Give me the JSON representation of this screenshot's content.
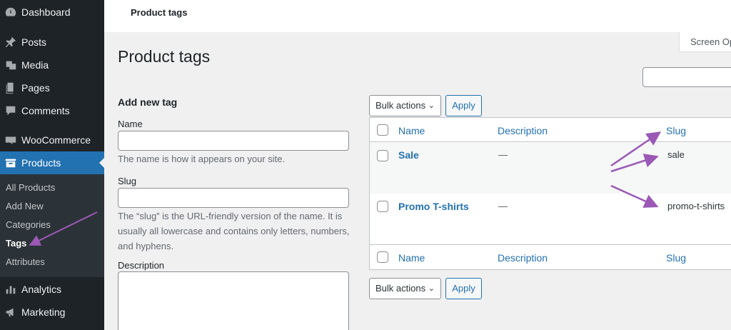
{
  "sidebar": {
    "items": [
      {
        "label": "Dashboard",
        "icon": "dashboard-icon"
      },
      {
        "label": "Posts",
        "icon": "pin-icon"
      },
      {
        "label": "Media",
        "icon": "media-icon"
      },
      {
        "label": "Pages",
        "icon": "pages-icon"
      },
      {
        "label": "Comments",
        "icon": "comments-icon"
      },
      {
        "label": "WooCommerce",
        "icon": "woocommerce-icon"
      },
      {
        "label": "Products",
        "icon": "products-icon"
      },
      {
        "label": "Analytics",
        "icon": "analytics-icon"
      },
      {
        "label": "Marketing",
        "icon": "megaphone-icon"
      }
    ],
    "submenu": [
      "All Products",
      "Add New",
      "Categories",
      "Tags",
      "Attributes"
    ]
  },
  "topbar": {
    "title": "Product tags"
  },
  "screen_options": "Screen Options",
  "page_title": "Product tags",
  "form": {
    "heading": "Add new tag",
    "name_label": "Name",
    "name_help": "The name is how it appears on your site.",
    "slug_label": "Slug",
    "slug_help": "The “slug” is the URL-friendly version of the name. It is usually all lowercase and contains only letters, numbers, and hyphens.",
    "description_label": "Description"
  },
  "actions": {
    "bulk_label": "Bulk actions",
    "apply_label": "Apply"
  },
  "table": {
    "columns": [
      "Name",
      "Description",
      "Slug"
    ],
    "rows": [
      {
        "name": "Sale",
        "description": "—",
        "slug": "sale"
      },
      {
        "name": "Promo T-shirts",
        "description": "—",
        "slug": "promo-t-shirts"
      }
    ]
  },
  "colors": {
    "accent": "#2271b1",
    "sidebar": "#1d2327",
    "annotation": "#9b59b6"
  }
}
